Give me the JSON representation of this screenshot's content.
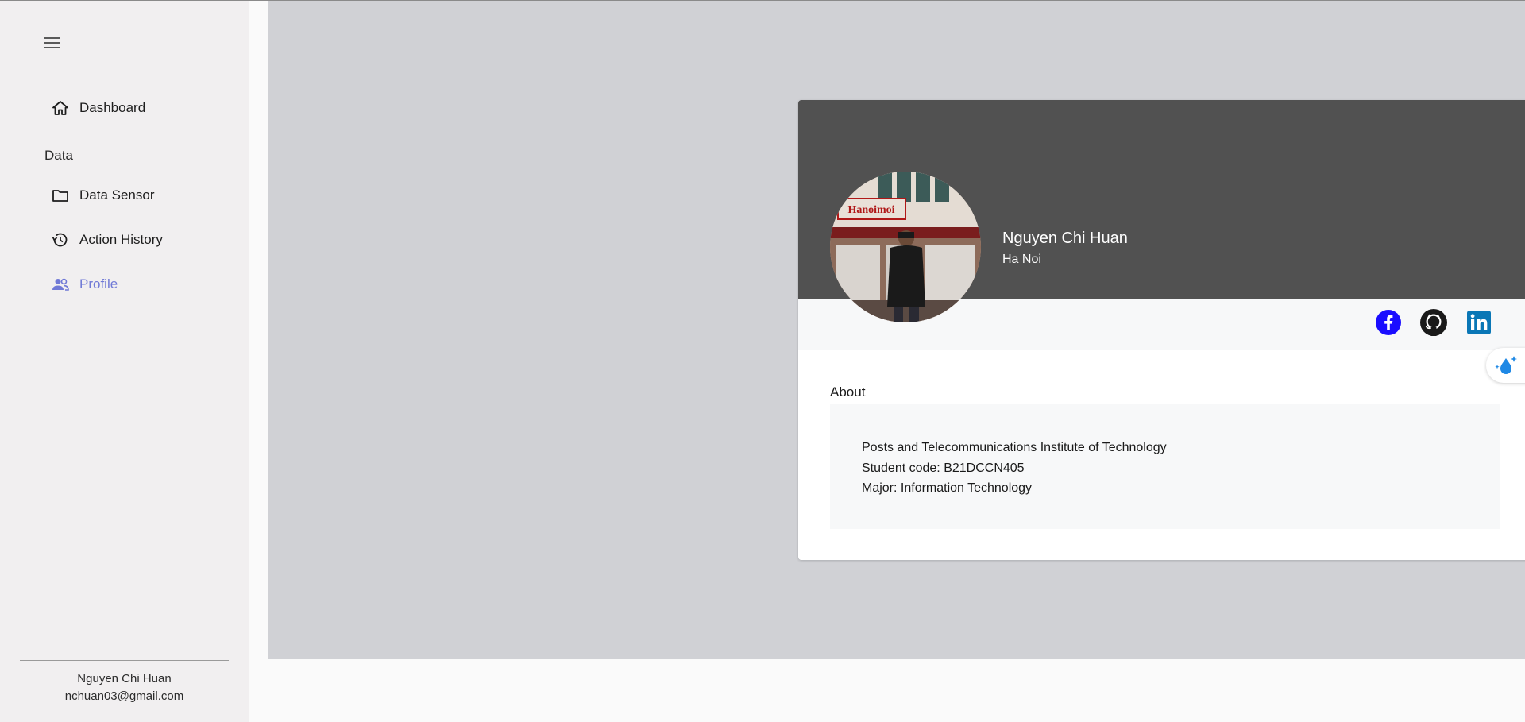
{
  "sidebar": {
    "menu_icon": "hamburger-menu-icon",
    "items": [
      {
        "label": "Dashboard",
        "icon": "home-icon"
      },
      {
        "label": "Data Sensor",
        "icon": "folder-icon"
      },
      {
        "label": "Action History",
        "icon": "history-icon"
      },
      {
        "label": "Profile",
        "icon": "people-icon"
      }
    ],
    "section_label": "Data",
    "active_item": "Profile",
    "footer": {
      "name": "Nguyen Chi Huan",
      "email": "nchuan03@gmail.com"
    }
  },
  "profile": {
    "name": "Nguyen Chi Huan",
    "city": "Ha Noi",
    "avatar_sign_text": "Hanoimoi",
    "social": [
      "facebook-icon",
      "github-icon",
      "linkedin-icon"
    ]
  },
  "about": {
    "title": "About",
    "lines": [
      "Posts and Telecommunications Institute of Technology",
      "Student code: B21DCCN405",
      "Major: Information Technology"
    ]
  },
  "colors": {
    "accent": "#7079d6",
    "header": "#515151",
    "facebook": "#1a0dff",
    "linkedin": "#0a77b6"
  },
  "floating_widget": {
    "icon": "water-sparkle-icon"
  }
}
